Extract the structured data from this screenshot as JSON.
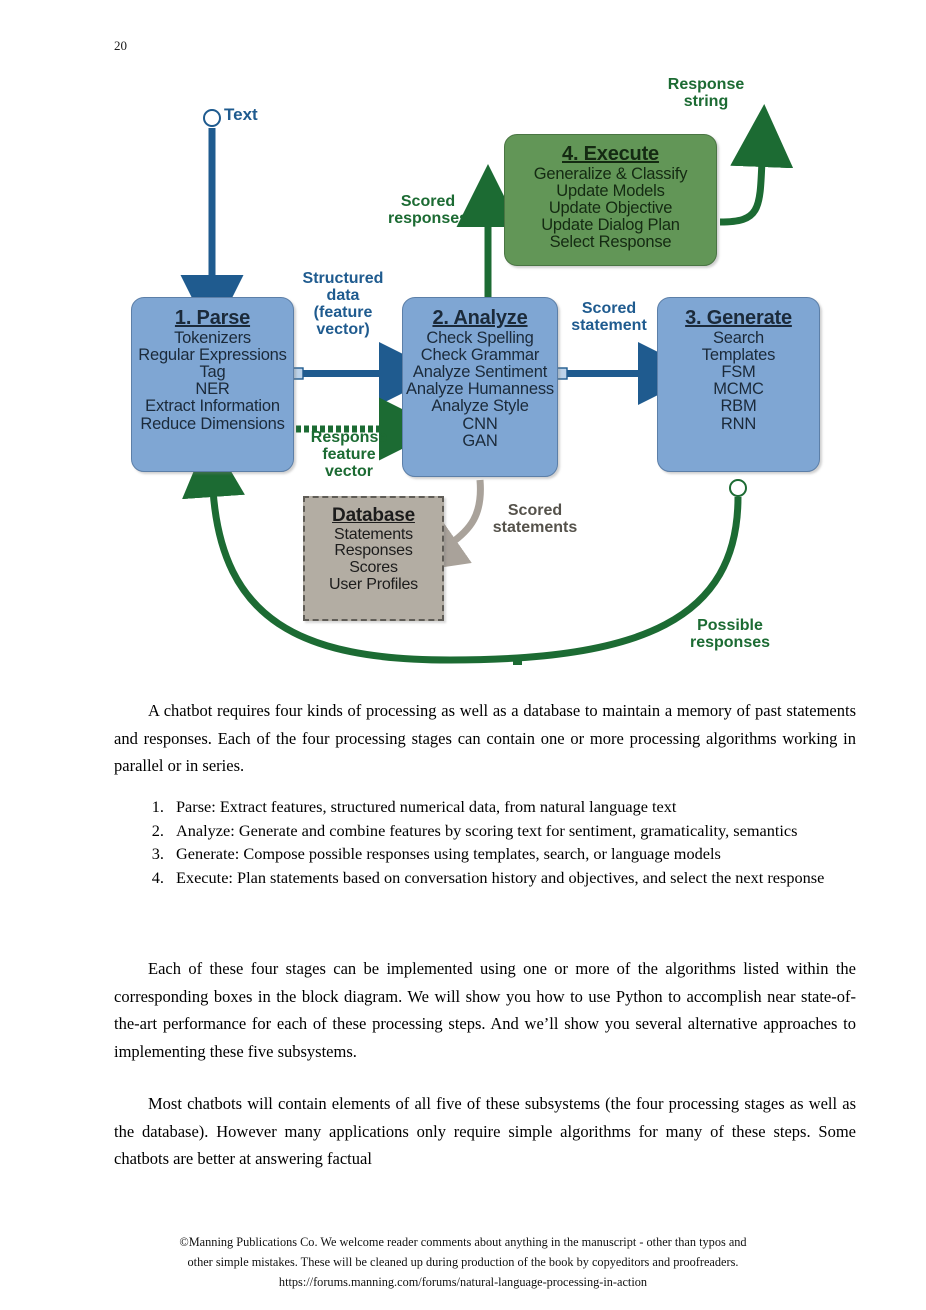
{
  "page": {
    "number": "20"
  },
  "figure": {
    "nodes": [
      {
        "id": "parse",
        "title": "1. Parse",
        "items": [
          "Tokenizers",
          "Regular Expressions",
          "Tag",
          "NER",
          "Extract Information",
          "Reduce Dimensions"
        ],
        "color": "#7FA6D3"
      },
      {
        "id": "analyze",
        "title": "2. Analyze",
        "items": [
          "Check Spelling",
          "Check Grammar",
          "Analyze Sentiment",
          "Analyze Humanness",
          "Analyze Style",
          "CNN",
          "GAN"
        ],
        "color": "#7FA6D3"
      },
      {
        "id": "generate",
        "title": "3. Generate",
        "items": [
          "Search",
          "Templates",
          "FSM",
          "MCMC",
          "RBM",
          "RNN"
        ],
        "color": "#7FA6D3"
      },
      {
        "id": "execute",
        "title": "4. Execute",
        "items": [
          "Generalize & Classify",
          "Update Models",
          "Update Objective",
          "Update Dialog Plan",
          "Select Response"
        ],
        "color": "#629657"
      },
      {
        "id": "database",
        "title": "Database",
        "items": [
          "Statements",
          "Responses",
          "Scores",
          "User Profiles"
        ],
        "color": "#B3ADA3"
      }
    ],
    "edge_labels": {
      "text": "Text",
      "structured_data": "Structured\ndata\n(feature\nvector)",
      "response_feature_vector": "Response\nfeature\nvector",
      "scored_responses": "Scored\nresponses",
      "response_string": "Response\nstring",
      "scored_statement": "Scored\nstatement",
      "scored_statements": "Scored\nstatements",
      "possible_responses": "Possible\nresponses"
    },
    "colors": {
      "blue_fill": "#7FA6D3",
      "blue_line": "#1F5B8F",
      "green_fill": "#629657",
      "green_line": "#1C6B33",
      "gray_fill": "#B3ADA3",
      "gray_line": "#A9A29A"
    }
  },
  "body": {
    "para1": "A chatbot requires four kinds of processing as well as a database to maintain a memory of past statements and responses. Each of the four processing stages can contain one or more processing algorithms working in parallel or in series.",
    "list": [
      "Parse: Extract features, structured numerical data, from natural language text",
      "Analyze: Generate and combine features by scoring text for sentiment, gramaticality, semantics",
      "Generate: Compose possible responses using templates, search, or language models",
      "Execute: Plan statements based on conversation history and objectives, and select the next response"
    ],
    "para2": "Each of these four stages can be implemented using one or more of the algorithms listed within the corresponding boxes in the block diagram. We will show you how to use Python to accomplish near state-of-the-art performance for each of these processing steps. And we’ll show you several alternative approaches to implementing these five subsystems.",
    "para3": "Most chatbots will contain elements of all five of these subsystems (the four processing stages as well as the database). However many applications only require simple algorithms for many of these steps. Some chatbots are better at answering factual"
  },
  "footer": {
    "line1": "©Manning Publications Co. We welcome reader comments about anything in the manuscript - other than typos and",
    "line2": "other simple mistakes. These will be cleaned up during production of the book by copyeditors and proofreaders.",
    "line3": "https://forums.manning.com/forums/natural-language-processing-in-action"
  }
}
